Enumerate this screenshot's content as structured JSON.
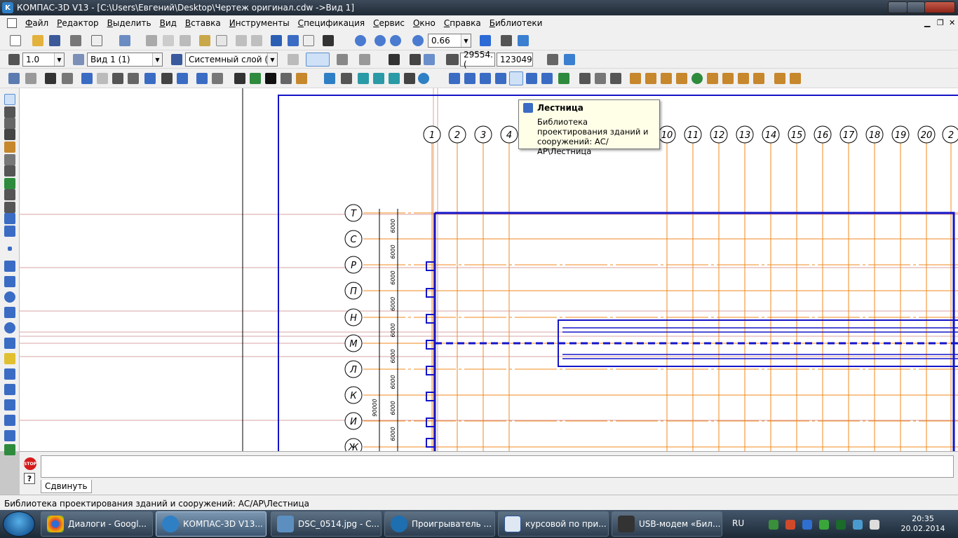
{
  "window": {
    "title": "КОМПАС-3D V13 - [C:\\Users\\Евгений\\Desktop\\Чертеж оригинал.cdw ->Вид 1]"
  },
  "menu": {
    "items": [
      "Файл",
      "Редактор",
      "Выделить",
      "Вид",
      "Вставка",
      "Инструменты",
      "Спецификация",
      "Сервис",
      "Окно",
      "Справка",
      "Библиотеки"
    ]
  },
  "toolbar1": {
    "zoom_value": "0.66"
  },
  "toolbar2": {
    "step_value": "1.0",
    "view_value": "Вид 1 (1)",
    "layer_value": "Системный слой (",
    "coord_x": "29554.(",
    "coord_y": "123049"
  },
  "tooltip": {
    "title": "Лестница",
    "description": "Библиотека проектирования зданий и сооружений: АС/АР\\Лестница"
  },
  "drawing": {
    "column_axes": [
      "1",
      "2",
      "3",
      "4",
      "10",
      "11",
      "12",
      "13",
      "14",
      "15",
      "16",
      "17",
      "18",
      "19",
      "20",
      "2"
    ],
    "row_axes": [
      "Т",
      "С",
      "Р",
      "П",
      "Н",
      "М",
      "Л",
      "К",
      "И",
      "Ж"
    ],
    "row_dimensions": [
      "6000",
      "6000",
      "6000",
      "6000",
      "6000",
      "6000",
      "6000",
      "6000",
      "6000",
      "6000"
    ],
    "total_dimension": "90000"
  },
  "command_panel": {
    "tab_label": "Сдвинуть"
  },
  "status_bar": {
    "text": "Библиотека проектирования зданий и сооружений: АС/АР\\Лестница"
  },
  "taskbar": {
    "tasks": [
      {
        "label": "Диалоги - Googl...",
        "icon": "chrome-icon"
      },
      {
        "label": "КОМПАС-3D V13...",
        "icon": "kompas-icon"
      },
      {
        "label": "DSC_0514.jpg - С...",
        "icon": "image-viewer-icon"
      },
      {
        "label": "Проигрыватель ...",
        "icon": "media-player-icon"
      },
      {
        "label": "курсовой по при...",
        "icon": "word-document-icon"
      },
      {
        "label": "USB-модем «Бил...",
        "icon": "usb-modem-icon"
      }
    ],
    "language": "RU",
    "time": "20:35",
    "date": "20.02.2014"
  }
}
